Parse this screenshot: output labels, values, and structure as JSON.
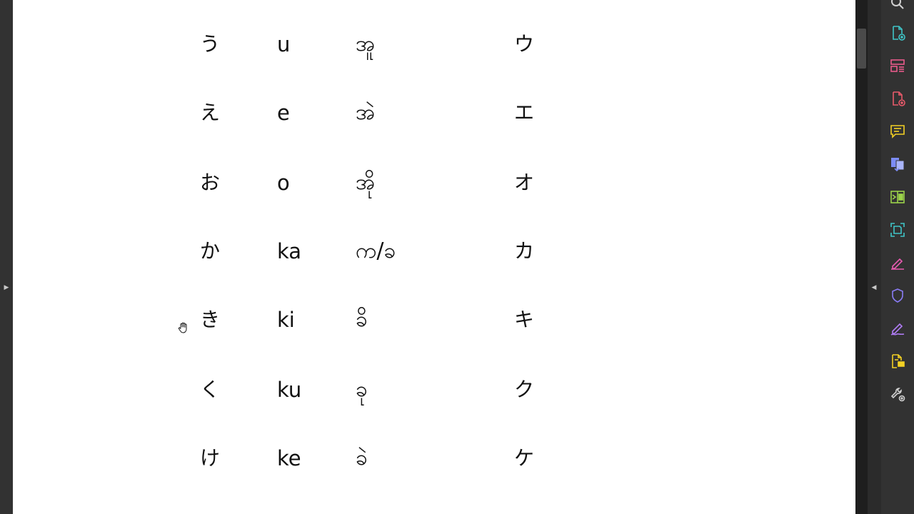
{
  "table": {
    "rows": [
      {
        "hiragana": "う",
        "romaji": "u",
        "burmese": "အူ",
        "katakana": "ウ"
      },
      {
        "hiragana": "え",
        "romaji": "e",
        "burmese": "အဲ",
        "katakana": "エ"
      },
      {
        "hiragana": "お",
        "romaji": "o",
        "burmese": "အို",
        "katakana": "オ"
      },
      {
        "hiragana": "か",
        "romaji": "ka",
        "burmese": "က/ခ",
        "katakana": "カ"
      },
      {
        "hiragana": "き",
        "romaji": "ki",
        "burmese": "ခိ",
        "katakana": "キ"
      },
      {
        "hiragana": "く",
        "romaji": "ku",
        "burmese": "ခု",
        "katakana": "ク"
      },
      {
        "hiragana": "け",
        "romaji": "ke",
        "burmese": "ခဲ",
        "katakana": "ケ"
      }
    ]
  },
  "tools_pane": {
    "icons": [
      {
        "name": "search-icon",
        "color": "#d0d0d0"
      },
      {
        "name": "create-pdf-icon",
        "color": "#3fc5c8"
      },
      {
        "name": "organize-pages-icon",
        "color": "#e85a8b"
      },
      {
        "name": "export-pdf-icon",
        "color": "#e85a6a"
      },
      {
        "name": "comment-icon",
        "color": "#f2d024"
      },
      {
        "name": "combine-files-icon",
        "color": "#7c8cf5"
      },
      {
        "name": "compress-pdf-icon",
        "color": "#9bd24a"
      },
      {
        "name": "scan-ocr-icon",
        "color": "#3fc5c8"
      },
      {
        "name": "edit-pdf-icon",
        "color": "#e85ab0"
      },
      {
        "name": "protect-icon",
        "color": "#8a7cf5"
      },
      {
        "name": "fill-sign-icon",
        "color": "#b07cf5"
      },
      {
        "name": "request-signature-icon",
        "color": "#f2d024"
      },
      {
        "name": "more-tools-icon",
        "color": "#d0d0d0"
      }
    ]
  }
}
